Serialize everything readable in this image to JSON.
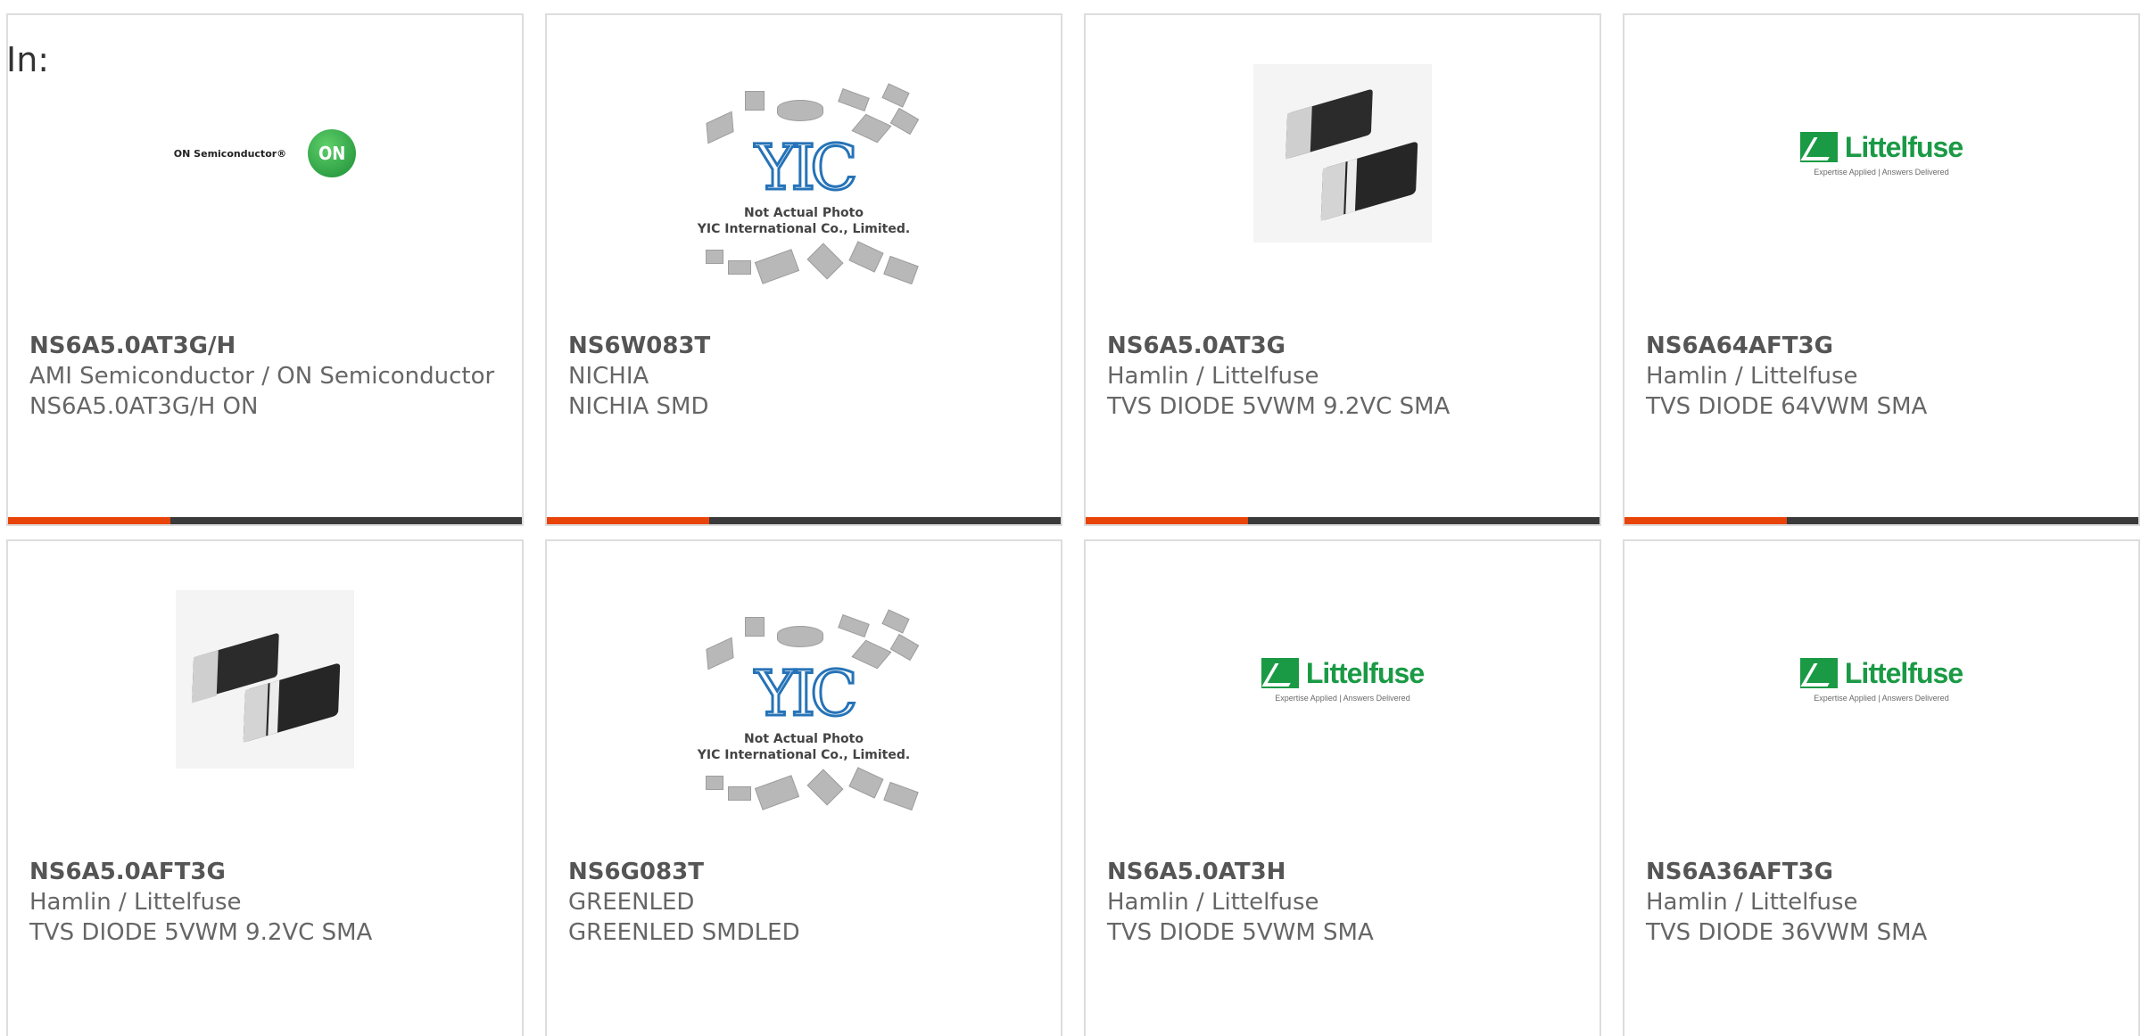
{
  "in_label": "In:",
  "cards": [
    {
      "part_number": "NS6A5.0AT3G/H",
      "maker": "AMI Semiconductor / ON Semiconductor",
      "desc": "NS6A5.0AT3G/H ON",
      "image": "on-semiconductor-logo",
      "logo_text": "ON Semiconductor®",
      "logo_mark": "ON"
    },
    {
      "part_number": "NS6W083T",
      "maker": "NICHIA",
      "desc": "NICHIA SMD",
      "image": "yic-placeholder",
      "caption_line1": "Not Actual Photo",
      "caption_line2": "YIC International Co., Limited."
    },
    {
      "part_number": "NS6A5.0AT3G",
      "maker": "Hamlin / Littelfuse",
      "desc": "TVS DIODE 5VWM 9.2VC SMA",
      "image": "sma-diode-photo"
    },
    {
      "part_number": "NS6A64AFT3G",
      "maker": "Hamlin / Littelfuse",
      "desc": "TVS DIODE 64VWM SMA",
      "image": "littelfuse-logo",
      "logo_word": "Littelfuse",
      "logo_tag": "Expertise Applied | Answers Delivered"
    },
    {
      "part_number": "NS6A5.0AFT3G",
      "maker": "Hamlin / Littelfuse",
      "desc": "TVS DIODE 5VWM 9.2VC SMA",
      "image": "sma-diode-photo"
    },
    {
      "part_number": "NS6G083T",
      "maker": "GREENLED",
      "desc": "GREENLED SMDLED",
      "image": "yic-placeholder",
      "caption_line1": "Not Actual Photo",
      "caption_line2": "YIC International Co., Limited."
    },
    {
      "part_number": "NS6A5.0AT3H",
      "maker": "Hamlin / Littelfuse",
      "desc": "TVS DIODE 5VWM SMA",
      "image": "littelfuse-logo",
      "logo_word": "Littelfuse",
      "logo_tag": "Expertise Applied | Answers Delivered"
    },
    {
      "part_number": "NS6A36AFT3G",
      "maker": "Hamlin / Littelfuse",
      "desc": "TVS DIODE 36VWM SMA",
      "image": "littelfuse-logo",
      "logo_word": "Littelfuse",
      "logo_tag": "Expertise Applied | Answers Delivered"
    }
  ],
  "colors": {
    "accent": "#e8440a",
    "bar": "#3a3a3a",
    "border": "#dddddd",
    "littelfuse_green": "#1a9a45",
    "yic_blue": "#2673b8"
  }
}
